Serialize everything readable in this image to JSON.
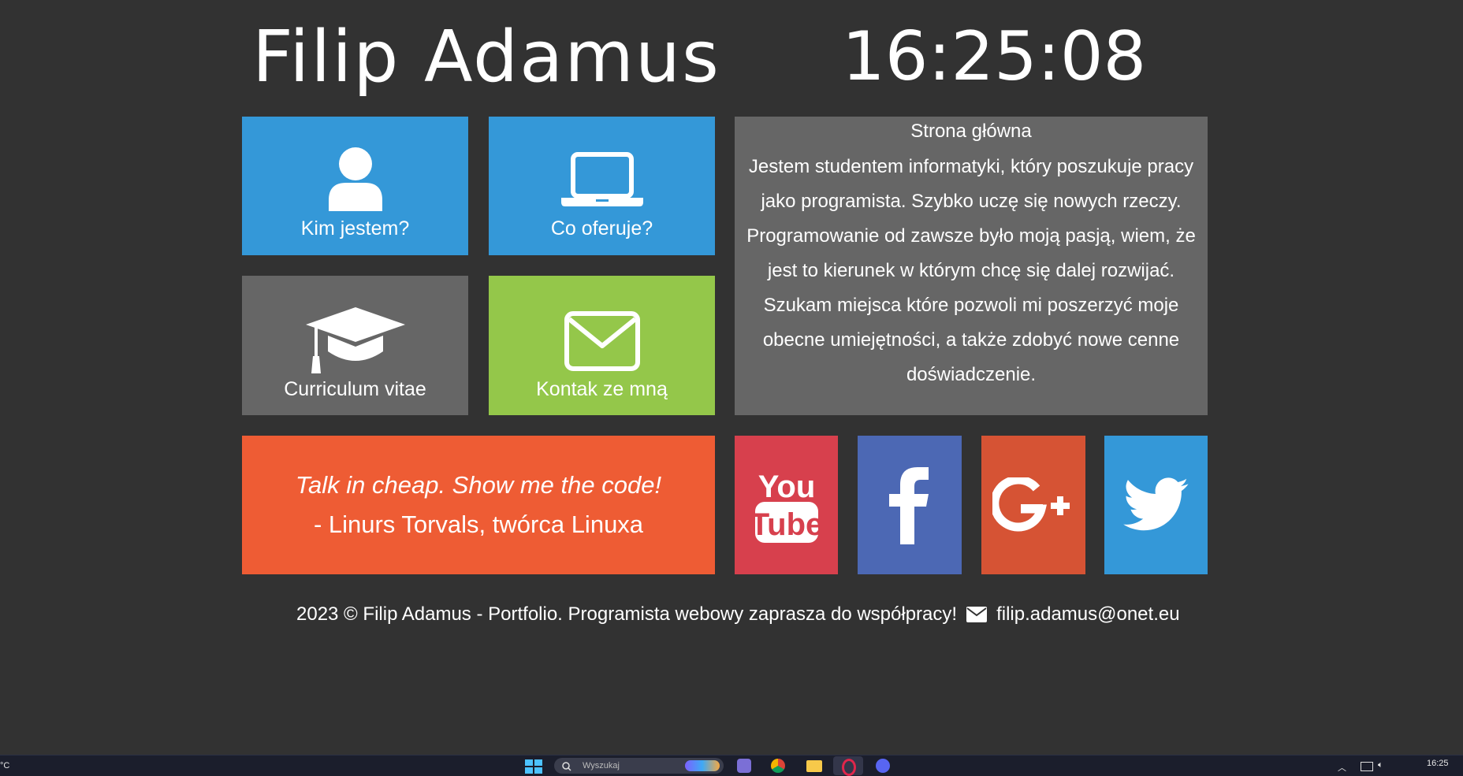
{
  "header": {
    "name": "Filip Adamus",
    "clock": "16:25:08"
  },
  "tiles": {
    "about_me": {
      "label": "Kim jestem?",
      "icon": "user-icon",
      "color": "#3498d8"
    },
    "offer": {
      "label": "Co oferuje?",
      "icon": "laptop-icon",
      "color": "#3498d8"
    },
    "cv": {
      "label": "Curriculum vitae",
      "icon": "graduation-cap-icon",
      "color": "#666666"
    },
    "contact": {
      "label": "Kontak ze mną",
      "icon": "envelope-icon",
      "color": "#94c74a"
    }
  },
  "about": {
    "title": "Strona główna",
    "text": "Jestem studentem informatyki, który poszukuje pracy jako programista. Szybko uczę się nowych rzeczy. Programowanie od zawsze było moją pasją, wiem, że jest to kierunek w którym chcę się dalej rozwijać. Szukam miejsca które pozwoli mi poszerzyć moje obecne umiejętności, a także zdobyć nowe cenne doświadczenie.",
    "color": "#666666"
  },
  "quote": {
    "text": "Talk in cheap. Show me the code!",
    "author": "- Linurs Torvals, twórca Linuxa",
    "color": "#ee5c34"
  },
  "social": [
    {
      "name": "youtube-icon",
      "color": "#d7404d"
    },
    {
      "name": "facebook-icon",
      "color": "#4c68b4"
    },
    {
      "name": "google-plus-icon",
      "color": "#d65334"
    },
    {
      "name": "twitter-icon",
      "color": "#3498d8"
    }
  ],
  "footer": {
    "copyright": "2023 © Filip Adamus - Portfolio. Programista webowy zaprasza do współpracy!",
    "email": "filip.adamus@onet.eu"
  },
  "taskbar": {
    "weather": "°C",
    "search_placeholder": "Wyszukaj",
    "time": "16:25"
  }
}
